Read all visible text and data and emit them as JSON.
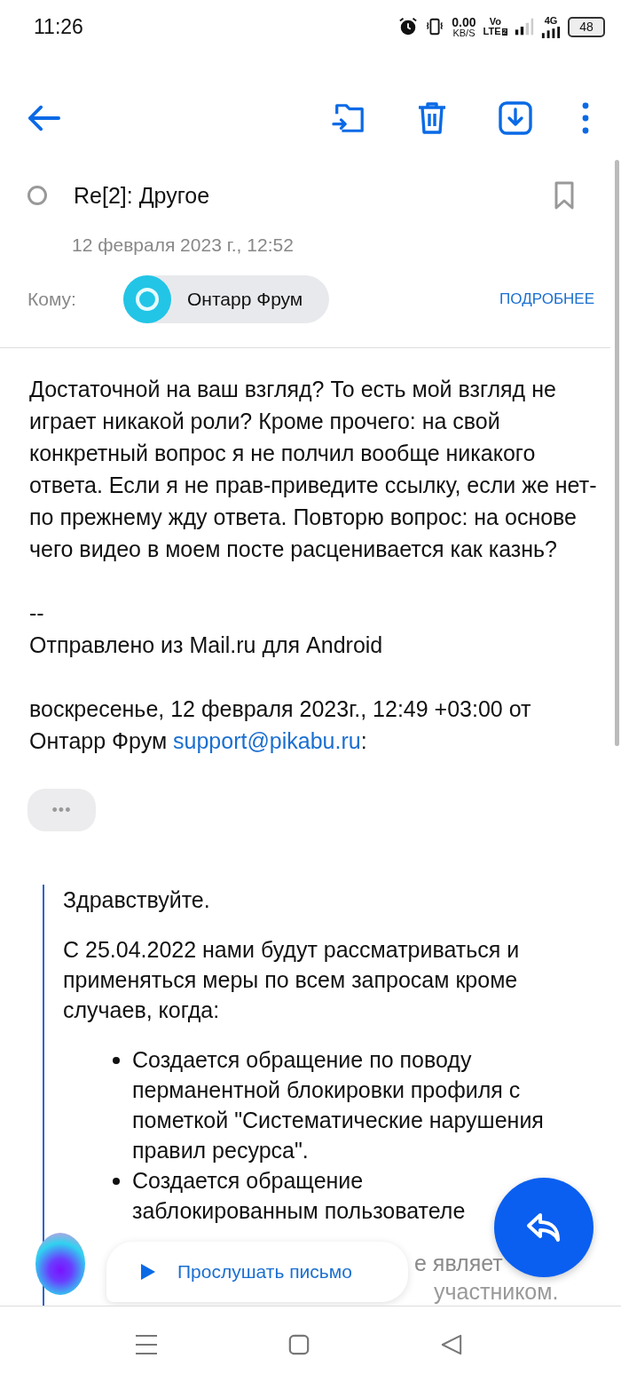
{
  "status_bar": {
    "time": "11:26",
    "speed_value": "0.00",
    "speed_unit": "KB/S",
    "volte_top": "Vo",
    "volte_bottom": "LTE",
    "sim": "2",
    "network": "4G",
    "battery": "48"
  },
  "message": {
    "subject": "Re[2]: Другое",
    "read": false,
    "bookmarked": false,
    "date": "12 февраля 2023 г., 12:52",
    "to_label": "Кому:",
    "recipient": "Онтарр Фрум",
    "details_link": "ПОДРОБНЕЕ"
  },
  "body": {
    "paragraphs": [
      {
        "text": "Достаточной на ваш взгляд? То есть мой взгляд не играет никакой роли? Кроме прочего: на свой конкретный вопрос я не полчил вообще никакого ответа. Если я не прав-приведите ссылку, если же нет-по прежнему жду ответа. Повторю вопрос: на основе чего видео в моем посте расценивается как казнь?"
      },
      {
        "lines": [
          "--",
          "Отправлено из Mail.ru для Android"
        ]
      },
      {
        "text": "воскресенье, 12 февраля 2023г., 12:49 +03:00 от Онтарр Фрум",
        "link": "support@pikabu.ru",
        "after": ":"
      }
    ],
    "expand_button": "•••",
    "quote": {
      "greeting": "Здравствуйте.",
      "intro": "С 25.04.2022 нами будут рассматриваться и применяться меры по всем запросам кроме случаев, когда:",
      "bullets": [
        "Создается обращение по поводу перманентной блокировки профиля с пометкой \"Систематические нарушения правил ресурса\".",
        "Создается обращение\nзаблокированным пользователе"
      ],
      "faded_lines": [
        "е являет",
        "участником."
      ]
    }
  },
  "listen_bubble": {
    "label": "Прослушать письмо"
  }
}
